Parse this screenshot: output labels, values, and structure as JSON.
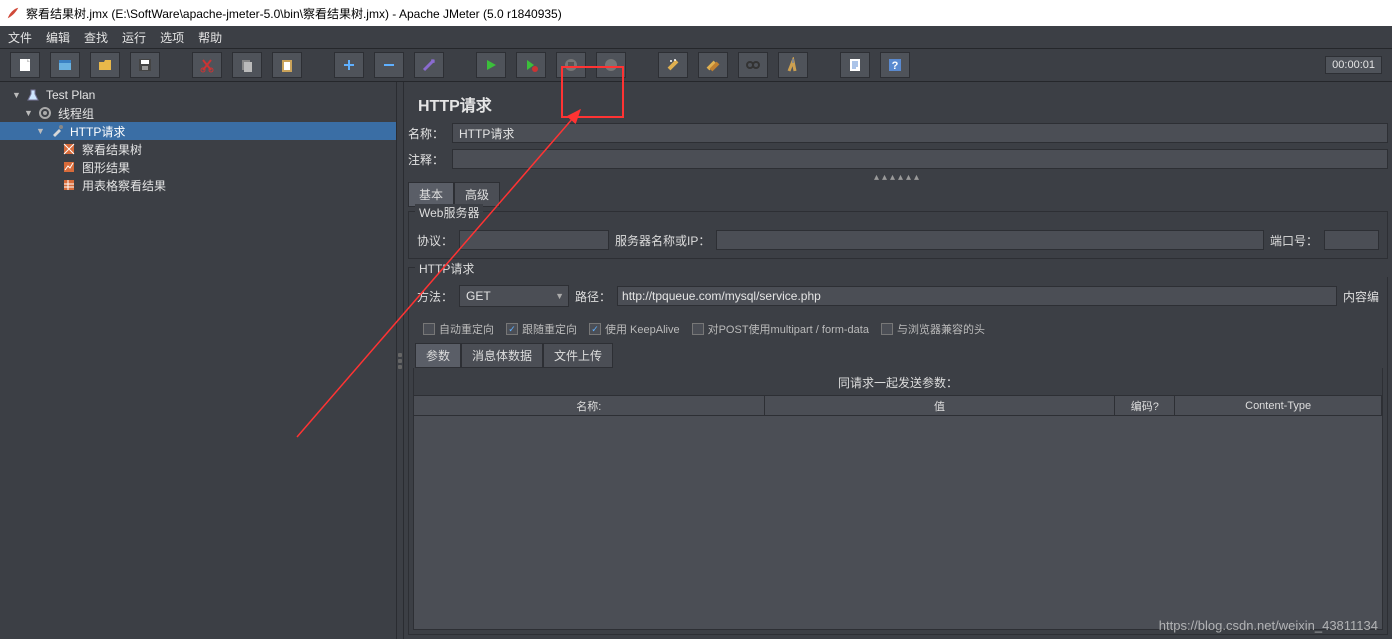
{
  "titlebar": {
    "text": "察看结果树.jmx (E:\\SoftWare\\apache-jmeter-5.0\\bin\\察看结果树.jmx) - Apache JMeter (5.0 r1840935)"
  },
  "menubar": {
    "file": "文件",
    "edit": "编辑",
    "search": "查找",
    "run": "运行",
    "options": "选项",
    "help": "帮助"
  },
  "toolbar": {
    "timer": "00:00:01"
  },
  "tree": {
    "test_plan": "Test Plan",
    "thread_group": "线程组",
    "http_request": "HTTP请求",
    "view_results_tree": "察看结果树",
    "graph_results": "图形结果",
    "table_results": "用表格察看结果"
  },
  "main": {
    "heading": "HTTP请求",
    "name_label": "名称：",
    "name_value": "HTTP请求",
    "comment_label": "注释：",
    "comment_value": "",
    "tabs": {
      "basic": "基本",
      "advanced": "高级"
    },
    "web_server_legend": "Web服务器",
    "protocol_label": "协议：",
    "protocol_value": "",
    "server_label": "服务器名称或IP：",
    "server_value": "",
    "port_label": "端口号：",
    "port_value": "",
    "http_request_legend": "HTTP请求",
    "method_label": "方法：",
    "method_value": "GET",
    "path_label": "路径：",
    "path_value": "http://tpqueue.com/mysql/service.php",
    "content_label": "内容编",
    "cb_auto_redirect": "自动重定向",
    "cb_follow_redirect": "跟随重定向",
    "cb_keepalive": "使用 KeepAlive",
    "cb_multipart": "对POST使用multipart / form-data",
    "cb_browser_headers": "与浏览器兼容的头",
    "params_tabs": {
      "params": "参数",
      "body": "消息体数据",
      "files": "文件上传"
    },
    "params_title": "同请求一起发送参数：",
    "table": {
      "col_name": "名称:",
      "col_value": "值",
      "col_encode": "编码?",
      "col_content_type": "Content-Type"
    }
  },
  "watermark": "https://blog.csdn.net/weixin_43811134"
}
